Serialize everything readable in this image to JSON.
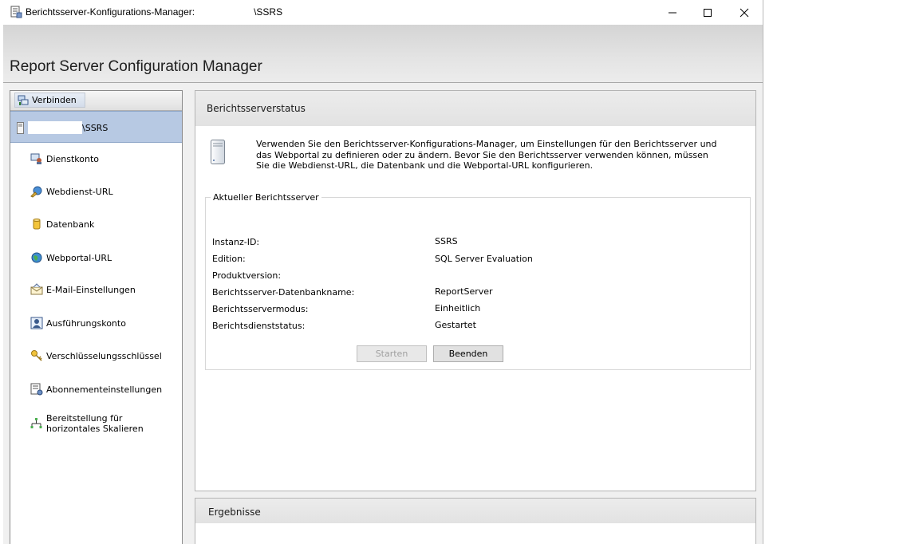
{
  "window": {
    "title": "Berichtsserver-Konfigurations-Manager:",
    "title_server": "\\SSRS",
    "controls": {
      "minimize": "minimize-icon",
      "maximize": "maximize-icon",
      "close": "close-icon"
    }
  },
  "header": {
    "title": "Report Server Configuration Manager"
  },
  "nav": {
    "connect_label": "Verbinden",
    "server_node_label": "\\SSRS",
    "items": [
      {
        "label": "Dienstkonto",
        "icon": "service-account-icon"
      },
      {
        "label": "Webdienst-URL",
        "icon": "web-service-url-icon"
      },
      {
        "label": "Datenbank",
        "icon": "database-icon"
      },
      {
        "label": "Webportal-URL",
        "icon": "web-portal-globe-icon"
      },
      {
        "label": "E-Mail-Einstellungen",
        "icon": "email-settings-icon"
      },
      {
        "label": "Ausführungskonto",
        "icon": "execution-account-icon"
      },
      {
        "label": "Verschlüsselungsschlüssel",
        "icon": "encryption-keys-icon"
      },
      {
        "label": "Abonnementeinstellungen",
        "icon": "subscription-settings-icon"
      },
      {
        "label": "Bereitstellung für horizontales Skalieren",
        "icon": "scale-out-deployment-icon"
      }
    ]
  },
  "status_panel": {
    "title": "Berichtsserverstatus",
    "intro": "Verwenden Sie den Berichtsserver-Konfigurations-Manager, um Einstellungen für den Berichtsserver und das Webportal zu definieren oder zu ändern. Bevor Sie den Berichtsserver verwenden können, müssen Sie die Webdienst-URL, die Datenbank und die Webportal-URL konfigurieren.",
    "group_title": "Aktueller Berichtsserver",
    "fields": [
      {
        "key": "Instanz-ID:",
        "value": "SSRS"
      },
      {
        "key": "Edition:",
        "value": "SQL Server Evaluation"
      },
      {
        "key": "Produktversion:",
        "value": ""
      },
      {
        "key": "Berichtsserver-Datenbankname:",
        "value": "ReportServer"
      },
      {
        "key": "Berichtsservermodus:",
        "value": "Einheitlich"
      },
      {
        "key": "Berichtsdienststatus:",
        "value": "Gestartet"
      }
    ],
    "start_label": "Starten",
    "stop_label": "Beenden"
  },
  "results_panel": {
    "title": "Ergebnisse"
  }
}
